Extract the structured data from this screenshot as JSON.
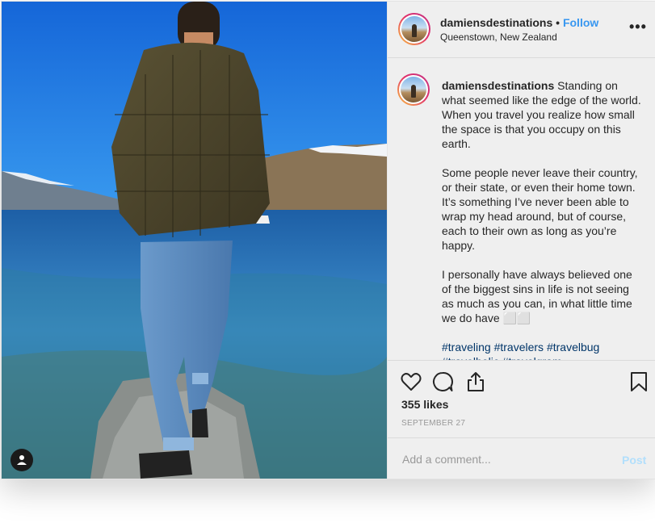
{
  "post": {
    "username": "damiensdestinations",
    "separator": "•",
    "follow_label": "Follow",
    "location": "Queenstown, New Zealand",
    "more_label": "•••",
    "caption": {
      "username": "damiensdestinations",
      "paragraph1": "Standing on what seemed like the edge of the world. When you travel you realize how small the space is that you occupy on this earth.",
      "paragraph2": "Some people never leave their country, or their state, or even their home town. It’s something I’ve never been able to wrap my head around, but of course, each to their own as long as you’re happy.",
      "paragraph3": "I personally have always believed one of the biggest sins in life is not seeing as much as you can, in what little time we do have ⬜⬜",
      "hashtags": "#traveling #travelers #travelbug #travelholic #travelgram"
    },
    "likes": "355 likes",
    "date": "SEPTEMBER 27",
    "comment_placeholder": "Add a comment...",
    "post_label": "Post"
  },
  "icons": {
    "like": "heart-icon",
    "comment": "comment-bubble-icon",
    "share": "share-icon",
    "save": "bookmark-icon",
    "user_tag": "user-tag-icon"
  },
  "colors": {
    "link": "#3897f0",
    "post_disabled": "#b2dffc",
    "panel_bg": "#efefef"
  }
}
